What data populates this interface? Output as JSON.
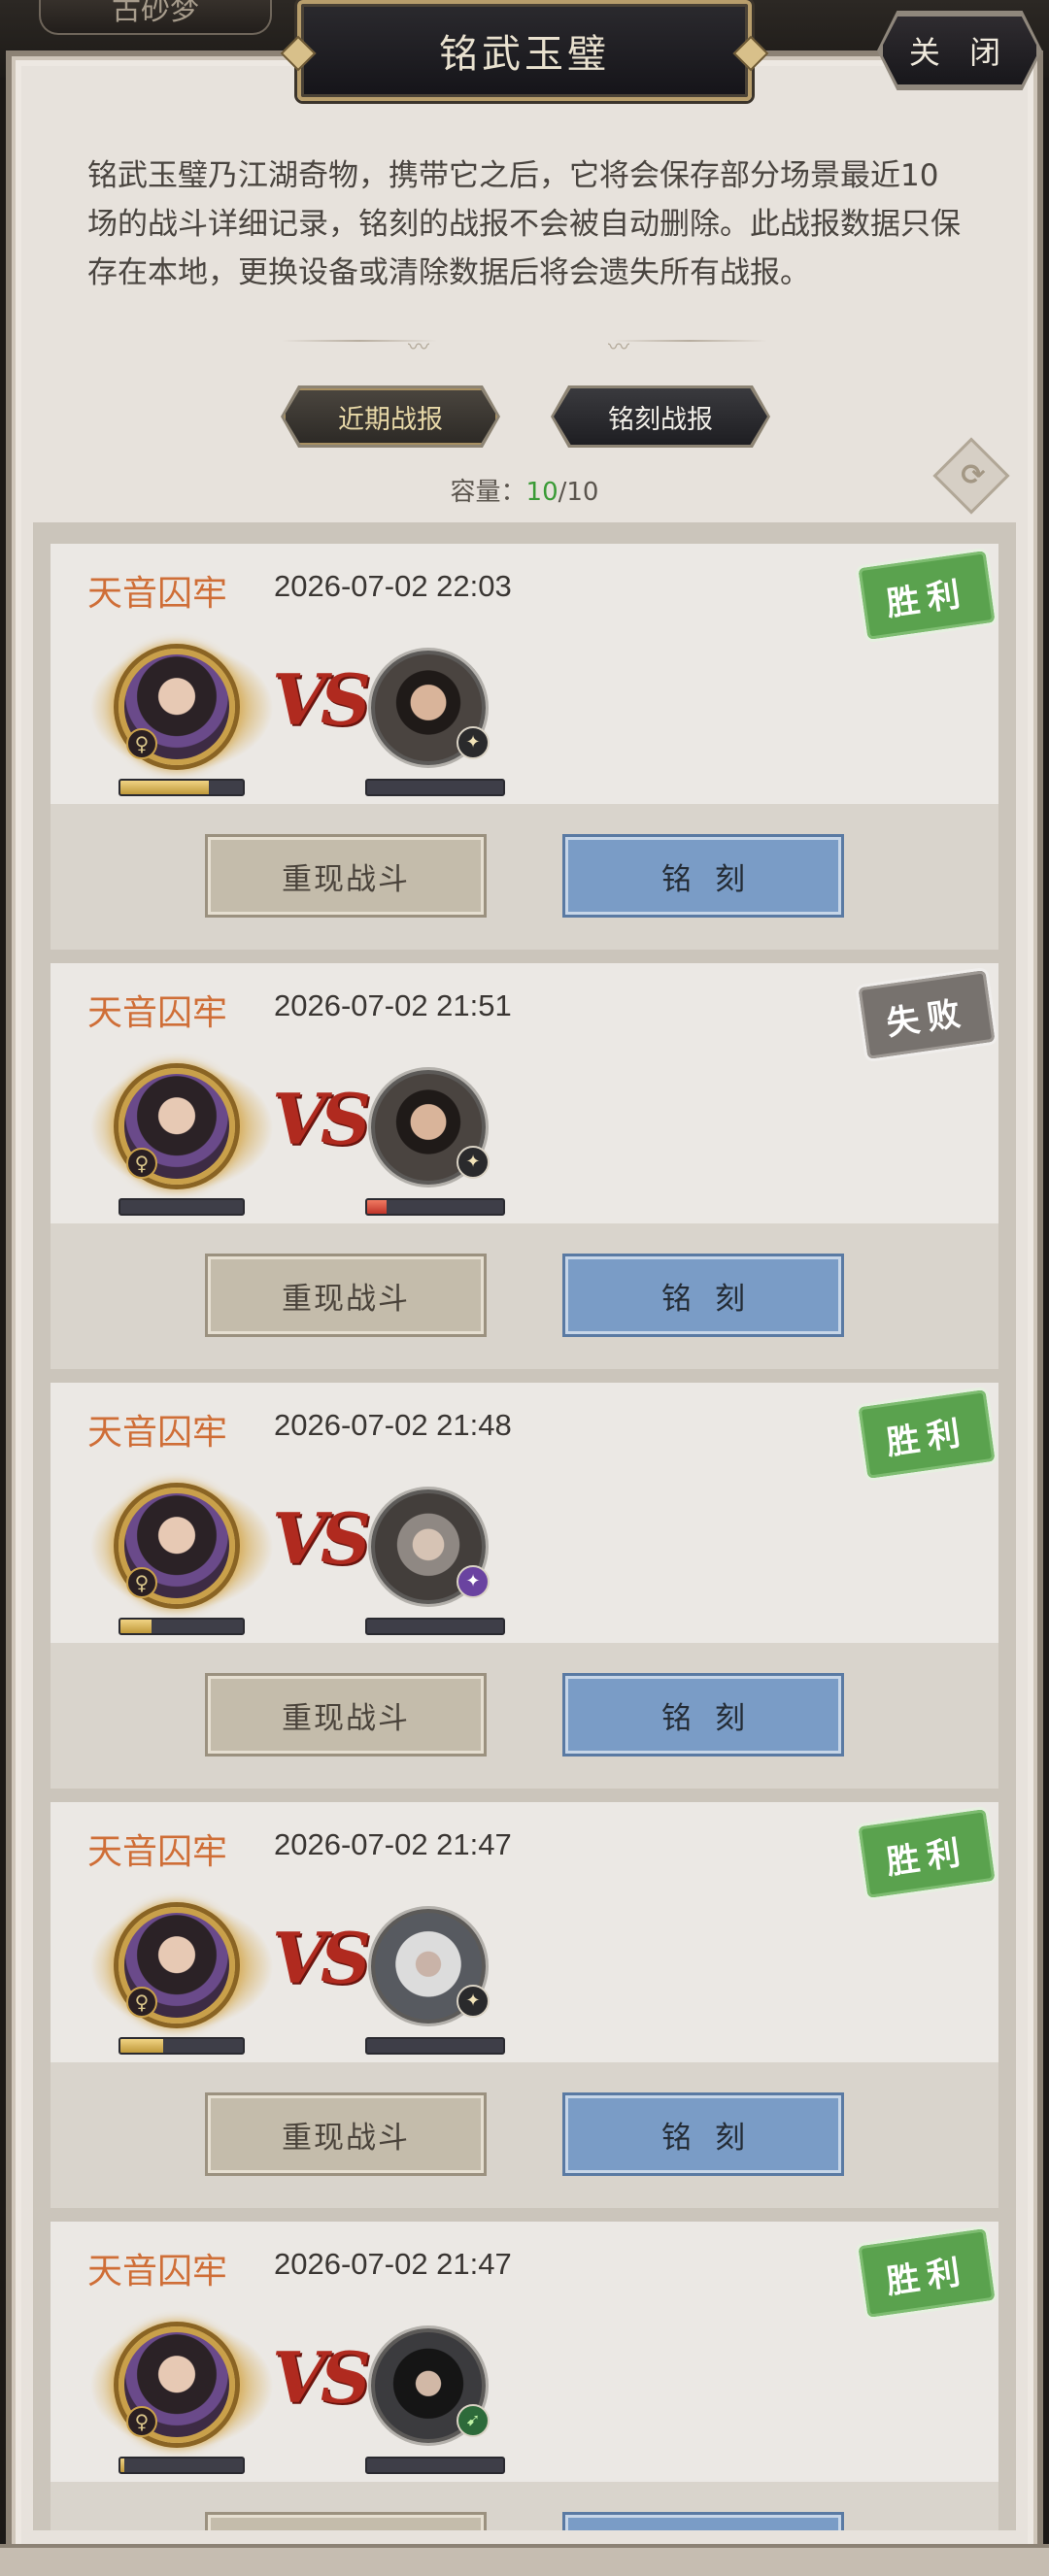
{
  "top_tab": {
    "label": "古砂梦"
  },
  "header": {
    "title": "铭武玉璧",
    "close_label": "关 闭"
  },
  "description": "铭武玉璧乃江湖奇物，携带它之后，它将会保存部分场景最近10场的战斗详细记录，铭刻的战报不会被自动删除。此战报数据只保存在本地，更换设备或清除数据后将会遗失所有战报。",
  "tabs": [
    {
      "label": "近期战报",
      "active": false
    },
    {
      "label": "铭刻战报",
      "active": true
    }
  ],
  "capacity": {
    "label": "容量：",
    "used": "10",
    "total": "/10"
  },
  "colors": {
    "win": "#5aa24e",
    "lose": "#77726e",
    "location": "#cf6e37",
    "engrave": "#7a9cc6"
  },
  "reports": [
    {
      "location": "天音囚牢",
      "time": "2026-07-02 22:03",
      "result": "胜利",
      "result_type": "win",
      "player_hp": 0.72,
      "enemy_hp": 0.0,
      "enemy_badge": "gold"
    },
    {
      "location": "天音囚牢",
      "time": "2026-07-02 21:51",
      "result": "失败",
      "result_type": "lose",
      "player_hp": 0.0,
      "enemy_hp": 0.14,
      "enemy_badge": "gold"
    },
    {
      "location": "天音囚牢",
      "time": "2026-07-02 21:48",
      "result": "胜利",
      "result_type": "win",
      "player_hp": 0.25,
      "enemy_hp": 0.0,
      "enemy_badge": "purple"
    },
    {
      "location": "天音囚牢",
      "time": "2026-07-02 21:47",
      "result": "胜利",
      "result_type": "win",
      "player_hp": 0.35,
      "enemy_hp": 0.0,
      "enemy_badge": "gold"
    },
    {
      "location": "天音囚牢",
      "time": "2026-07-02 21:47",
      "result": "胜利",
      "result_type": "win",
      "player_hp": 0.03,
      "enemy_hp": 0.0,
      "enemy_badge": "green"
    }
  ],
  "buttons": {
    "replay": "重现战斗",
    "engrave": "铭刻"
  },
  "vs_label": "VS"
}
